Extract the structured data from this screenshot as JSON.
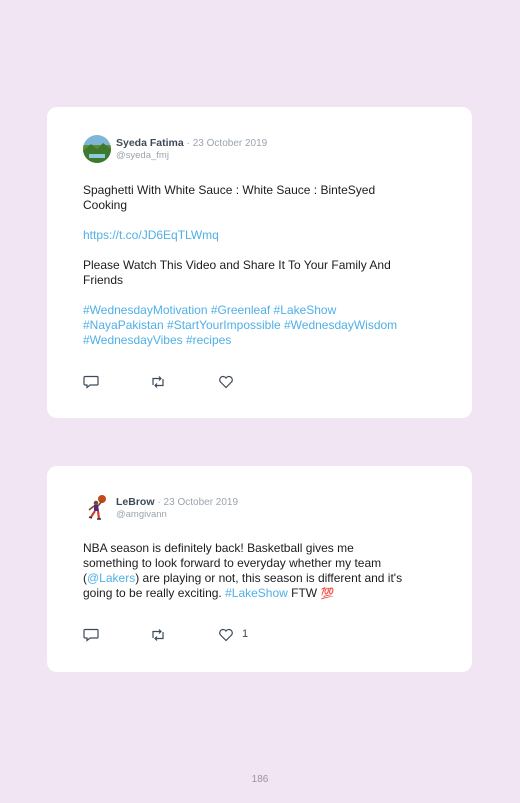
{
  "tweets": [
    {
      "author": "Syeda Fatima",
      "date": "· 23 October 2019",
      "handle": "@syeda_fmj",
      "line1": "Spaghetti With White Sauce : White Sauce : BinteSyed",
      "line2": "Cooking",
      "url": "https://t.co/JD6EqTLWmq",
      "line3": "Please Watch This Video and Share It To Your Family And",
      "line4": "Friends",
      "hashtags_line1": "#WednesdayMotivation #Greenleaf #LakeShow",
      "hashtags_line2": "#NayaPakistan #StartYourImpossible #WednesdayWisdom",
      "hashtags_line3": "#WednesdayVibes #recipes",
      "likes": ""
    },
    {
      "author": "LeBrow",
      "date": "· 23 October 2019",
      "handle": "@amgivann",
      "line1": "NBA season is definitely back! Basketball gives me",
      "line2": "something to look forward to everyday whether my team",
      "line3_open": "(",
      "mention": "@Lakers",
      "line3_rest": ") are playing or not, this season is different and it's",
      "line4_start": "going to be really exciting. ",
      "hashtag": "#LakeShow",
      "line4_end": " FTW ",
      "emoji": "💯",
      "likes": "1"
    }
  ],
  "icons": {
    "reply": "reply-icon",
    "retweet": "retweet-icon",
    "like": "heart-icon"
  },
  "colors": {
    "background": "#f1e4f3",
    "link": "#4fb0e6",
    "name": "#3d4a59",
    "muted": "#9aa4ae"
  },
  "page_number": "186"
}
